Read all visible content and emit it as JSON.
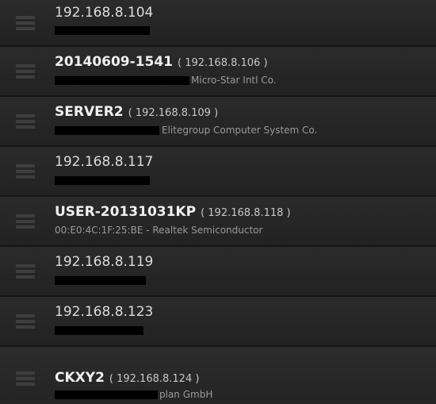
{
  "devices": [
    {
      "hostname": "",
      "ip": "192.168.8.104",
      "detail": ""
    },
    {
      "hostname": "20140609-1541",
      "ip": "( 192.168.8.106 )",
      "detail": "Micro-Star Intl Co."
    },
    {
      "hostname": "SERVER2",
      "ip": "( 192.168.8.109 )",
      "detail": "Elitegroup Computer System Co."
    },
    {
      "hostname": "",
      "ip": "192.168.8.117",
      "detail": ""
    },
    {
      "hostname": "USER-20131031KP",
      "ip": "( 192.168.8.118 )",
      "detail": "00:E0:4C:1F:25:BE - Realtek Semiconductor"
    },
    {
      "hostname": "",
      "ip": "192.168.8.119",
      "detail": ""
    },
    {
      "hostname": "",
      "ip": "192.168.8.123",
      "detail": ""
    },
    {
      "hostname": "CKXY2",
      "ip": "( 192.168.8.124 )",
      "detail": "plan GmbH"
    }
  ],
  "icon": "server-rack-icon",
  "colors": {
    "background": "#262626",
    "divider": "#141414",
    "primary_text": "#f0f0f0",
    "secondary_text": "#9a9a9a",
    "redaction": "#000000"
  }
}
